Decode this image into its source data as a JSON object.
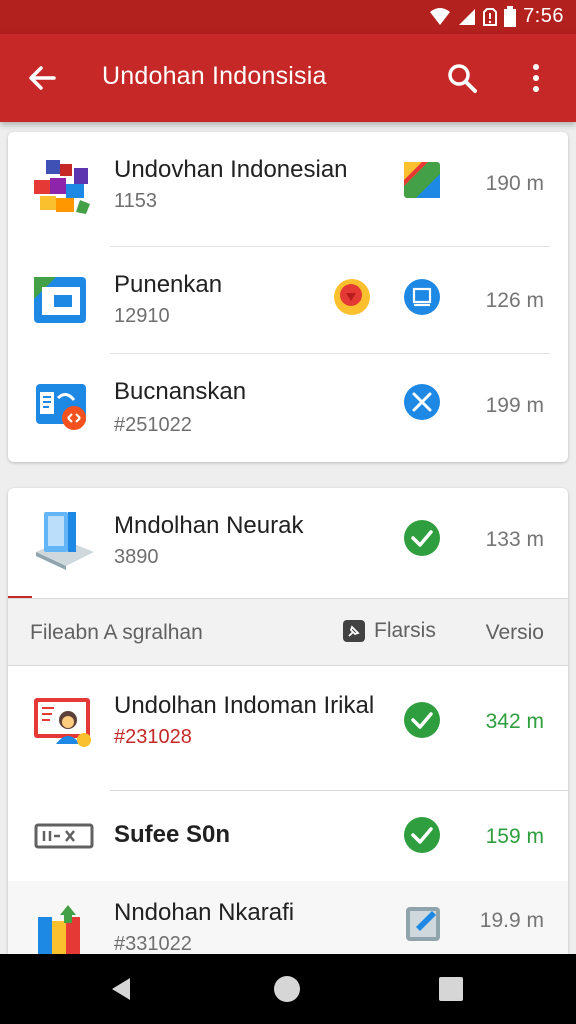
{
  "status_bar": {
    "time": "7:56"
  },
  "app_bar": {
    "title": "Undohan Indonsisia"
  },
  "card1": {
    "items": [
      {
        "title": "Undovhan Indonesian",
        "subtitle": "1153",
        "size": "190 m"
      },
      {
        "title": "Punenkan",
        "subtitle": "12910",
        "size": "126 m"
      },
      {
        "title": "Bucnanskan",
        "subtitle": "#251022",
        "size": "199 m"
      }
    ]
  },
  "card2": {
    "top_item": {
      "title": "Mndolhan Neurak",
      "subtitle": "3890",
      "size": "133 m"
    },
    "section_header": {
      "left": "Fileabn A sgralhan",
      "mid": "Flarsis",
      "right": "Versio"
    },
    "items": [
      {
        "title": "Undolhan Indoman Irikal",
        "subtitle": "#231028",
        "size": "342 m"
      },
      {
        "title": "Sufee S0n",
        "size": "159 m"
      },
      {
        "title": "Nndohan Nkarafi",
        "subtitle": "#331022",
        "size": "19.9 m"
      }
    ]
  },
  "colors": {
    "primary": "#c62828",
    "status_bar": "#b3211f",
    "success": "#2e9e3e"
  }
}
